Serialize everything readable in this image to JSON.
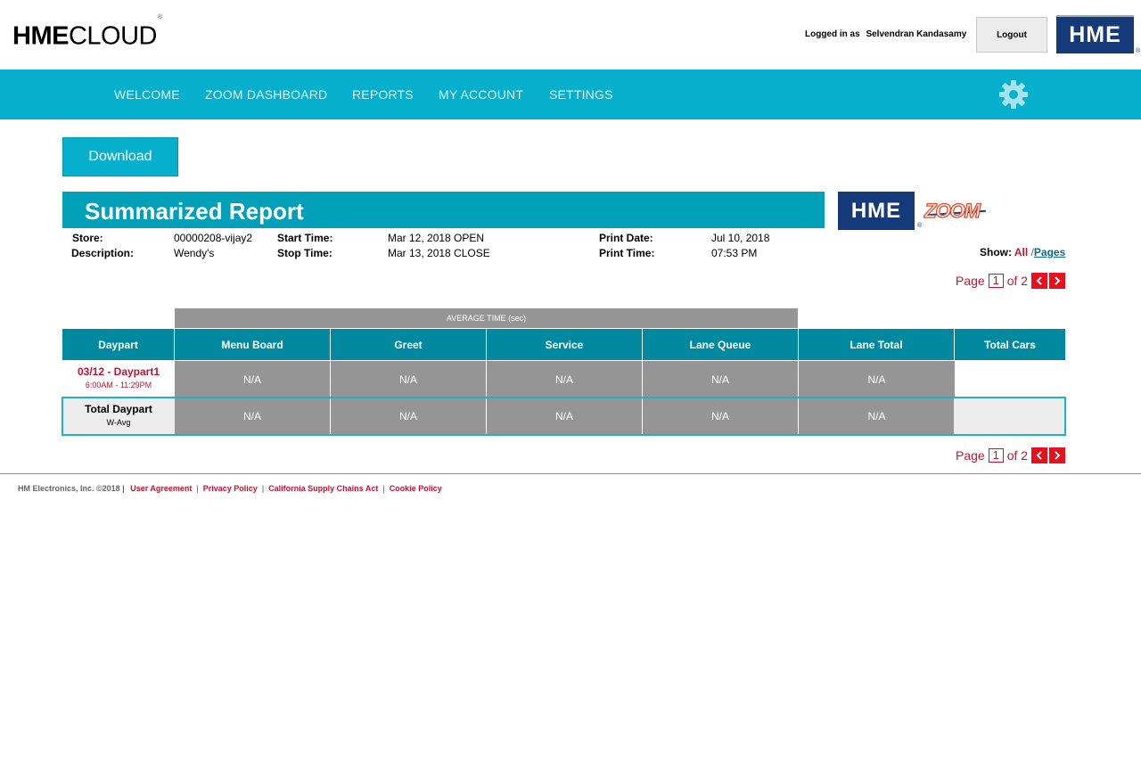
{
  "header": {
    "brand_bold": "HME",
    "brand_light": "CLOUD",
    "brand_reg": "®",
    "logged_in_label": "Logged in as",
    "user_name": "Selvendran Kandasamy",
    "logout_label": "Logout",
    "hme_logo_text": "HME",
    "hme_logo_reg": "®"
  },
  "nav": {
    "items": [
      {
        "label": "WELCOME"
      },
      {
        "label": "ZOOM DASHBOARD"
      },
      {
        "label": "REPORTS"
      },
      {
        "label": "MY ACCOUNT"
      },
      {
        "label": "SETTINGS"
      }
    ],
    "settings_icon": "gear-icon"
  },
  "toolbar": {
    "download_label": "Download"
  },
  "report": {
    "title": "Summarized Report",
    "logo_hme": "HME",
    "logo_reg": "®",
    "logo_zoom": "ZOOM",
    "store_label": "Store:",
    "store_value": "00000208-vijay2",
    "description_label": "Description:",
    "description_value": "Wendy's",
    "start_label": "Start Time:",
    "start_value": "Mar 12, 2018 OPEN",
    "stop_label": "Stop Time:",
    "stop_value": "Mar 13, 2018 CLOSE",
    "print_date_label": "Print Date:",
    "print_date_value": "Jul 10, 2018",
    "print_time_label": "Print Time:",
    "print_time_value": "07:53 PM",
    "show_label": "Show:",
    "show_all": "All",
    "show_sep": "/",
    "show_pages": "Pages"
  },
  "pager": {
    "page_label": "Page",
    "current": "1",
    "of_label": "of 2"
  },
  "table": {
    "group_header": "AVERAGE TIME (sec)",
    "columns": [
      "Daypart",
      "Menu Board",
      "Greet",
      "Service",
      "Lane Queue",
      "Lane Total",
      "Total Cars"
    ],
    "rows": [
      {
        "daypart": "03/12 - Daypart1",
        "sub": "6:00AM - 11:29PM",
        "cells": [
          "N/A",
          "N/A",
          "N/A",
          "N/A",
          "N/A"
        ]
      }
    ],
    "total": {
      "label": "Total Daypart",
      "sub": "W-Avg",
      "cells": [
        "N/A",
        "N/A",
        "N/A",
        "N/A",
        "N/A"
      ]
    }
  },
  "footer": {
    "copyright": "HM Electronics, Inc. ©2018 |",
    "links": [
      "User Agreement",
      "Privacy Policy",
      "California Supply Chains Act",
      "Cookie Policy"
    ]
  },
  "colors": {
    "nav_bg": "#06b0cc",
    "title_bg": "#00a0b9",
    "table_header": "#00899f",
    "cell_gray": "#959595",
    "accent_red": "#c8102e",
    "hme_blue": "#153a7a"
  }
}
